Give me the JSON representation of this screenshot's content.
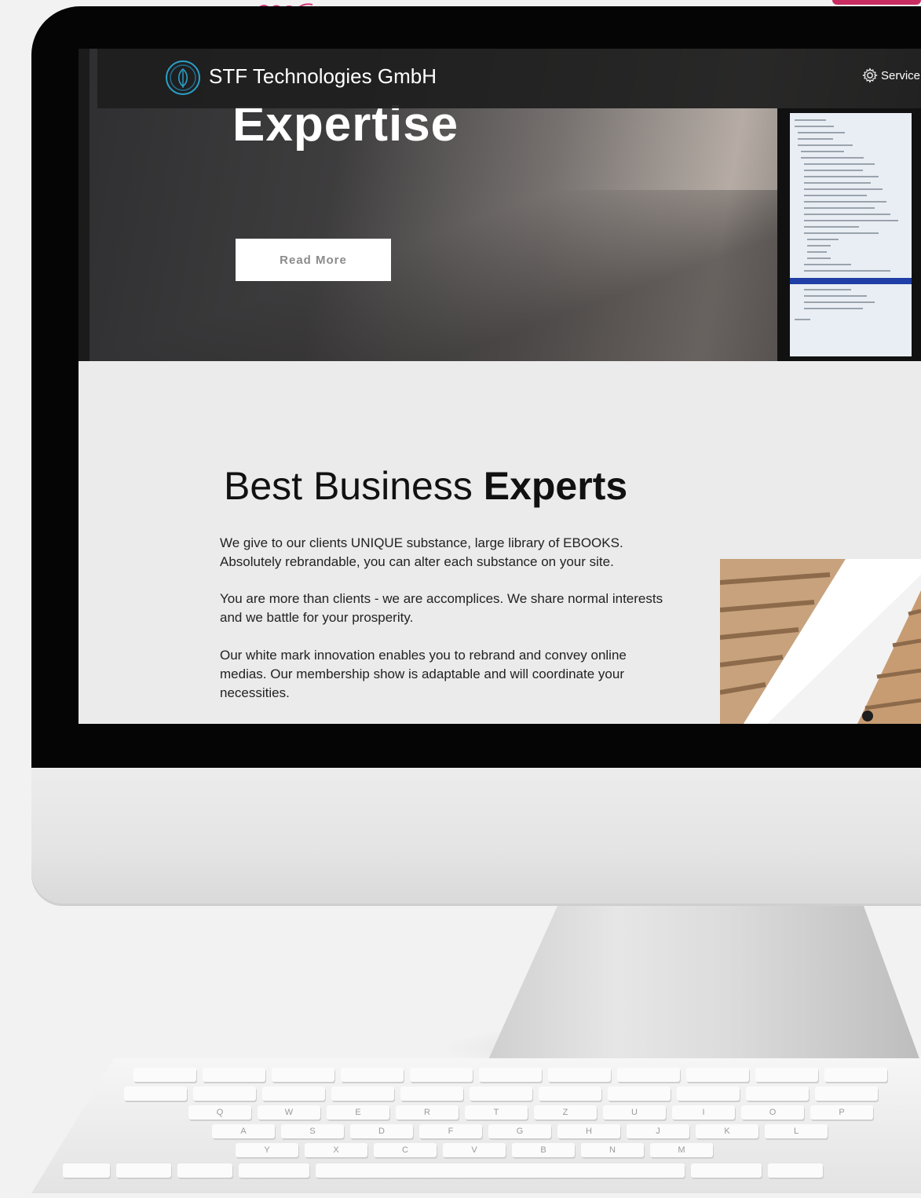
{
  "navbar": {
    "brand": "STF Technologies GmbH",
    "service_label": "Service"
  },
  "hero": {
    "title": "Expertise",
    "button_label": "Read More"
  },
  "section": {
    "title_light": "Best Business",
    "title_bold": "Experts",
    "paragraphs": [
      "We give to our clients UNIQUE substance, large library of EBOOKS. Absolutely rebrandable, you can alter each substance on your site.",
      "You are more than clients - we are accomplices. We share normal interests and we battle for your prosperity.",
      "Our white mark innovation enables you to rebrand and convey online medias. Our membership show is adaptable and will coordinate your necessities."
    ]
  },
  "keyboard": {
    "row1": [
      "Q",
      "W",
      "E",
      "R",
      "T",
      "Z",
      "U",
      "I",
      "O",
      "P"
    ],
    "row2": [
      "A",
      "S",
      "D",
      "F",
      "G",
      "H",
      "J",
      "K",
      "L"
    ],
    "row3": [
      "Y",
      "X",
      "C",
      "V",
      "B",
      "N",
      "M"
    ]
  },
  "colors": {
    "accent": "#2aa0c8",
    "navbar": "#1e1e1e",
    "content_bg": "#ebebeb"
  }
}
